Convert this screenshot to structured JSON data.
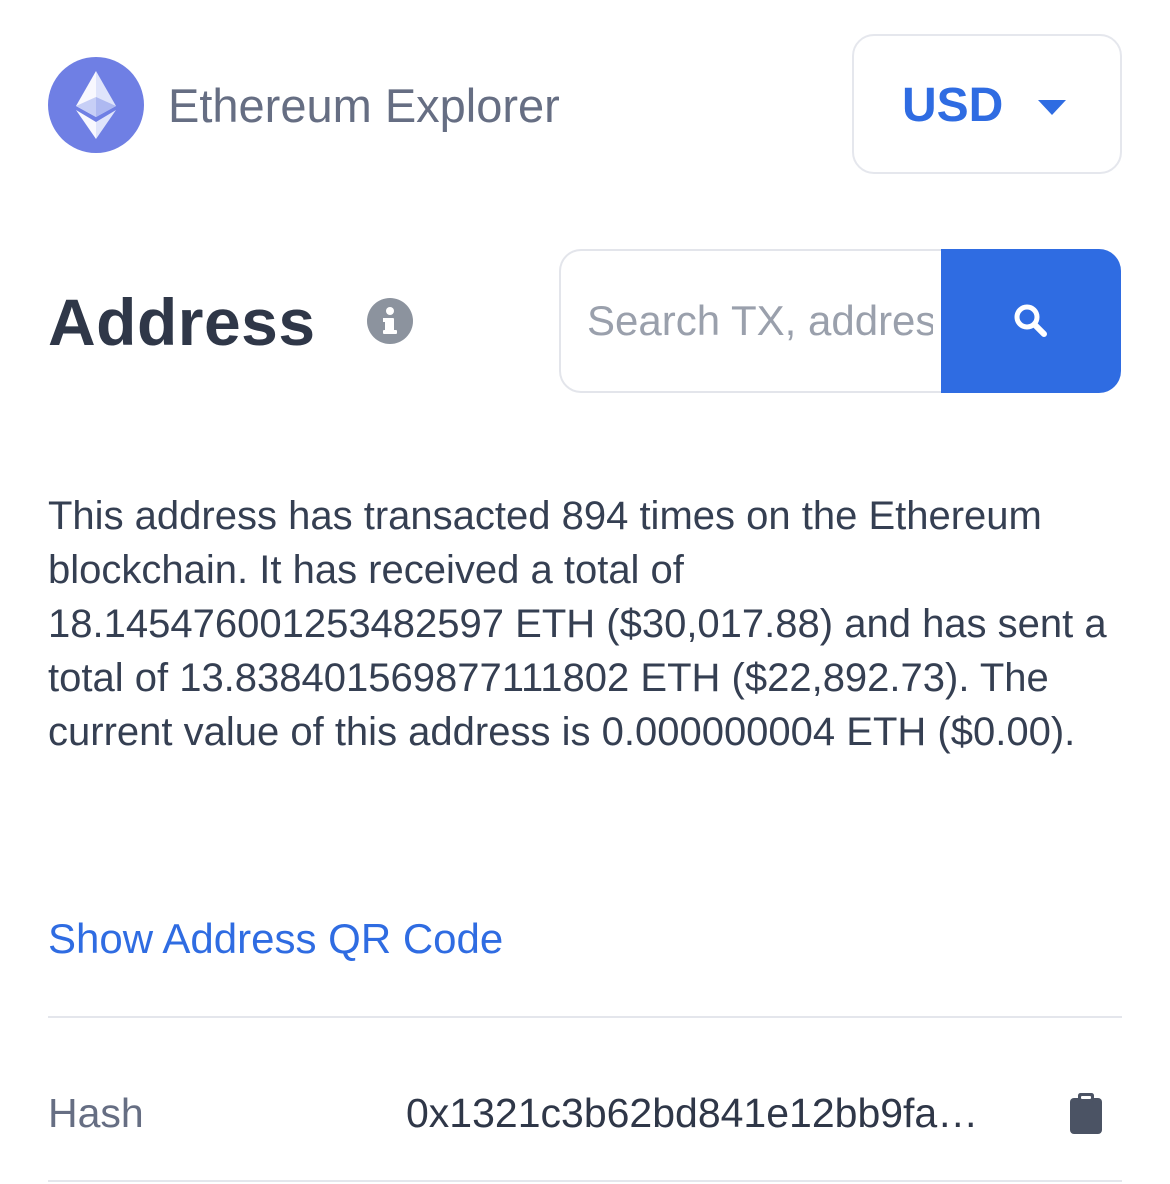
{
  "header": {
    "logo": "ethereum-logo",
    "title": "Ethereum Explorer",
    "currency": "USD",
    "currency_icon": "caret-down-icon"
  },
  "page": {
    "title": "Address",
    "title_icon": "info-icon"
  },
  "search": {
    "placeholder": "Search TX, address",
    "button_icon": "search-icon"
  },
  "summary": {
    "text": "This address has transacted 894 times on the Ethereum blockchain. It has received a total of 18.145476001253482597 ETH ($30,017.88) and has sent a total of 13.838401569877111802 ETH ($22,892.73). The current value of this address is 0.000000004 ETH ($0.00)."
  },
  "qr_link": {
    "label": "Show Address QR Code"
  },
  "details": {
    "hash_label": "Hash",
    "hash_value": "0x1321c3b62bd841e12bb9fa…",
    "copy_icon": "clipboard-icon"
  },
  "colors": {
    "accent": "#2f6ce2",
    "logo_bg": "#6f7fe4",
    "text": "#353f52",
    "muted": "#666e83"
  }
}
